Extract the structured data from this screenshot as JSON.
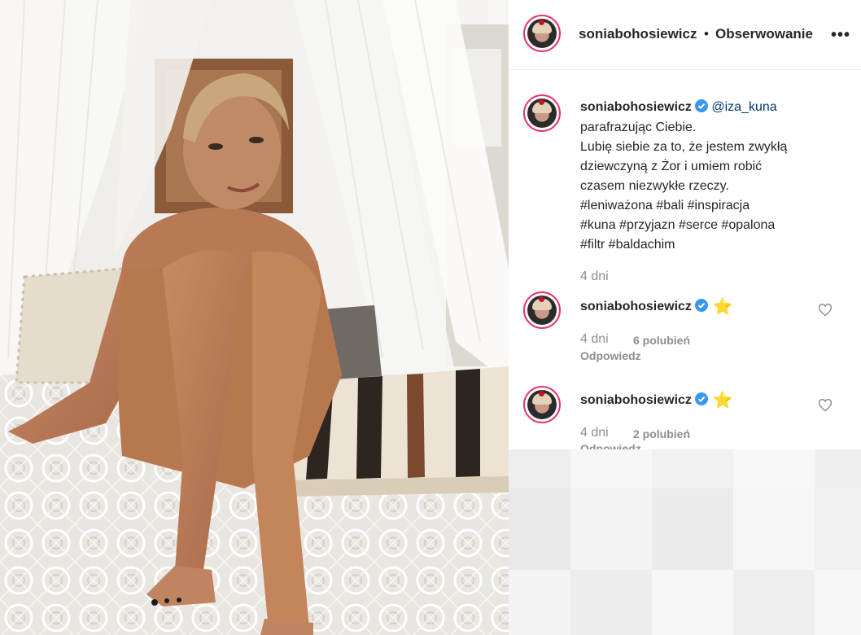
{
  "post": {
    "username": "soniabohosiewicz",
    "dot": "•",
    "follow_label": "Obserwowanie",
    "more_label": "•••"
  },
  "caption": {
    "username": "soniabohosiewicz",
    "mention": "@iza_kuna",
    "lines": [
      "parafrazując Ciebie.",
      "Lubię siebie za to, że jestem zwykłą",
      "dziewczyną z Żor i umiem robić",
      "czasem niezwykłe rzeczy."
    ],
    "hashtag_lines": [
      "#leniważona #bali #inspiracja",
      "#kuna #przyjazn #serce #opalona",
      "#filtr #baldachim"
    ],
    "time": "4 dni"
  },
  "comments": [
    {
      "username": "soniabohosiewicz",
      "emoji": "⭐",
      "time": "4 dni",
      "likes": "6 polubień",
      "reply": "Odpowiedz"
    },
    {
      "username": "soniabohosiewicz",
      "emoji": "⭐",
      "time": "4 dni",
      "likes": "2 polubień",
      "reply": "Odpowiedz"
    }
  ],
  "icons": {
    "verified": "verified-badge-icon",
    "heart": "heart-icon",
    "more": "more-options-icon"
  },
  "colors": {
    "hashtag": "#00376b",
    "muted": "#8e8e8e",
    "verified": "#3897f0",
    "story_ring": "#e8336d"
  }
}
